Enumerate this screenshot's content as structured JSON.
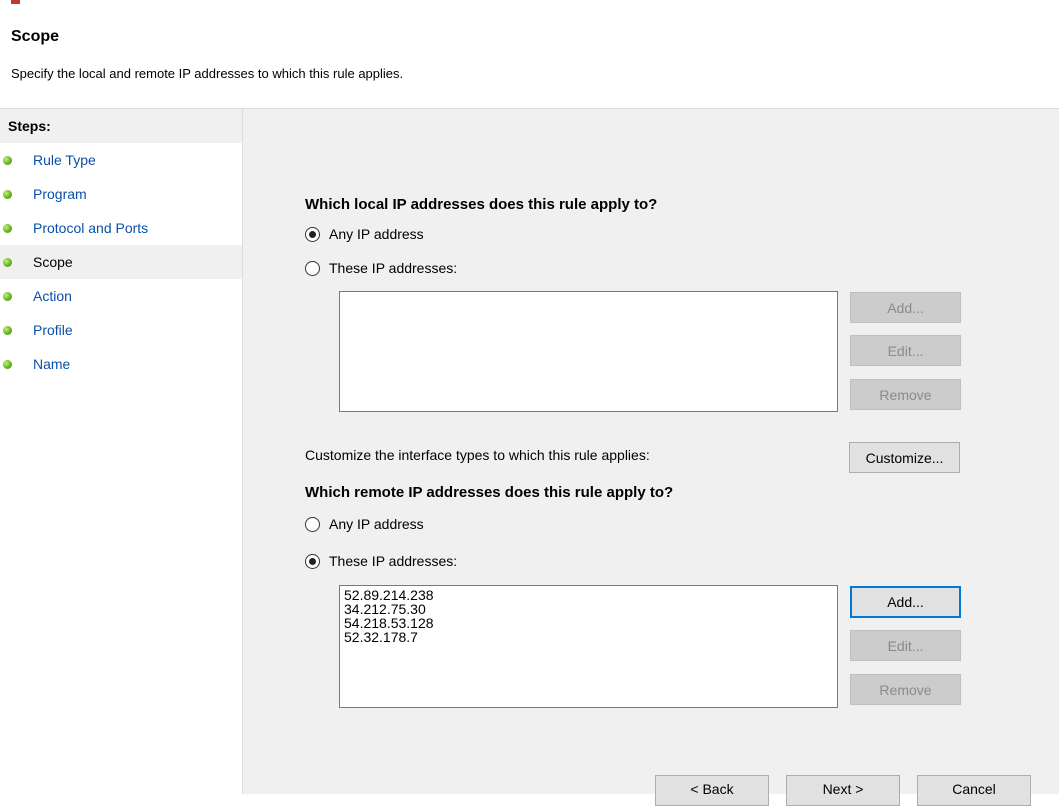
{
  "header": {
    "title": "Scope",
    "subtitle": "Specify the local and remote IP addresses to which this rule applies."
  },
  "sidebar": {
    "steps_label": "Steps:",
    "items": [
      {
        "label": "Rule Type"
      },
      {
        "label": "Program"
      },
      {
        "label": "Protocol and Ports"
      },
      {
        "label": "Scope",
        "current": true
      },
      {
        "label": "Action"
      },
      {
        "label": "Profile"
      },
      {
        "label": "Name"
      }
    ]
  },
  "local": {
    "question": "Which local IP addresses does this rule apply to?",
    "any_label": "Any IP address",
    "these_label": "These IP addresses:",
    "selected": "any",
    "addresses": [],
    "add_label": "Add...",
    "edit_label": "Edit...",
    "remove_label": "Remove"
  },
  "interface": {
    "text": "Customize the interface types to which this rule applies:",
    "customize_label": "Customize..."
  },
  "remote": {
    "question": "Which remote IP addresses does this rule apply to?",
    "any_label": "Any IP address",
    "these_label": "These IP addresses:",
    "selected": "these",
    "addresses": [
      "52.89.214.238",
      "34.212.75.30",
      "54.218.53.128",
      "52.32.178.7"
    ],
    "add_label": "Add...",
    "edit_label": "Edit...",
    "remove_label": "Remove"
  },
  "footer": {
    "back_label": "< Back",
    "next_label": "Next >",
    "cancel_label": "Cancel"
  }
}
